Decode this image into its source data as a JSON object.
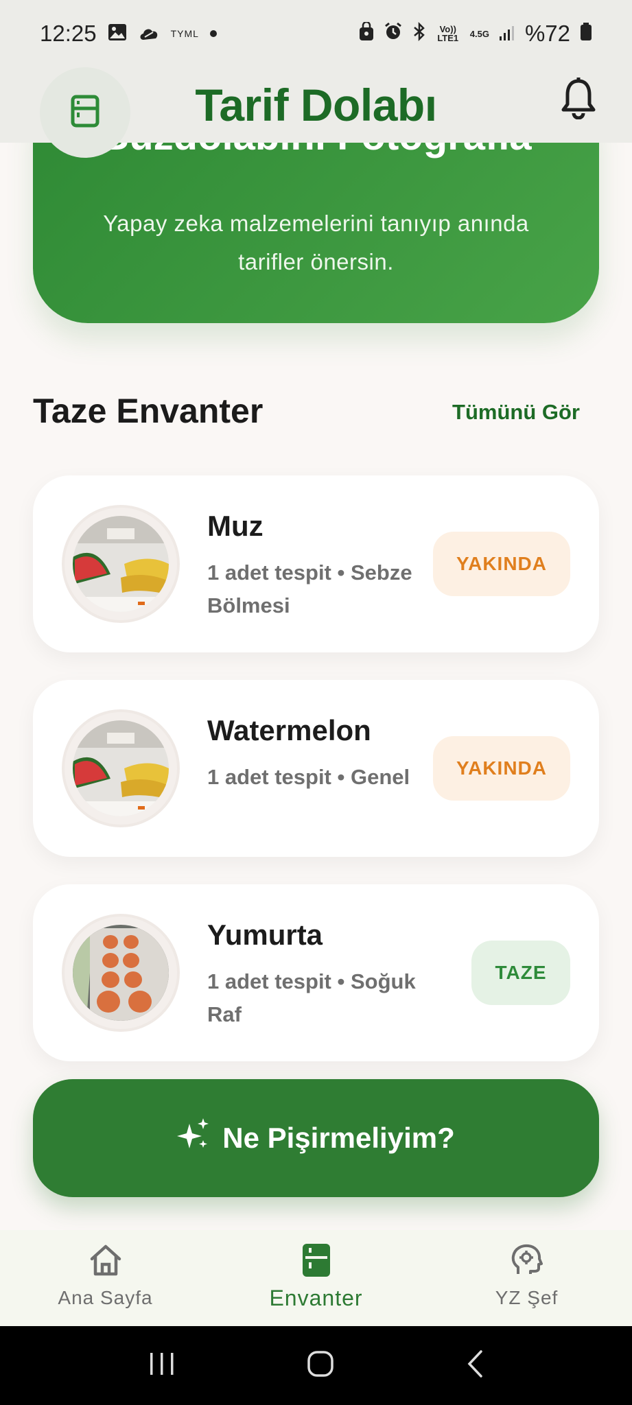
{
  "status_bar": {
    "time": "12:25",
    "carrier_tag": "TYML",
    "volte": "Vo)) LTE1",
    "network": "4.5G",
    "battery": "%72"
  },
  "app_bar": {
    "title": "Tarif Dolabı",
    "menu_icon": "fridge-icon",
    "bell_icon": "bell-icon"
  },
  "hero": {
    "title": "Buzdolabını Fotoğrafla",
    "subtitle": "Yapay zeka malzemelerini tanıyıp anında tarifler önersin."
  },
  "inventory": {
    "title": "Taze Envanter",
    "see_all": "Tümünü Gör",
    "items": [
      {
        "name": "Muz",
        "meta": "1 adet tespit • Sebze Bölmesi",
        "badge": "YAKINDA",
        "badge_color": "#e07f1e"
      },
      {
        "name": "Watermelon",
        "meta": "1 adet tespit • Genel",
        "badge": "YAKINDA",
        "badge_color": "#e07f1e"
      },
      {
        "name": "Yumurta",
        "meta": "1 adet tespit • Soğuk Raf",
        "badge": "TAZE",
        "badge_color": "#2e8b3a"
      }
    ]
  },
  "cook_button": {
    "label": "Ne Pişirmeliyim?",
    "icon": "sparkle-icon"
  },
  "bottom_nav": {
    "items": [
      {
        "label": "Ana Sayfa",
        "icon": "home-icon",
        "active": false
      },
      {
        "label": "Envanter",
        "icon": "fridge-icon",
        "active": true
      },
      {
        "label": "YZ Şef",
        "icon": "ai-chef-icon",
        "active": false
      }
    ]
  },
  "colors": {
    "primary": "#2f7d33",
    "title_green": "#1d6b26",
    "soon": "#e07f1e",
    "fresh": "#2e8b3a"
  }
}
